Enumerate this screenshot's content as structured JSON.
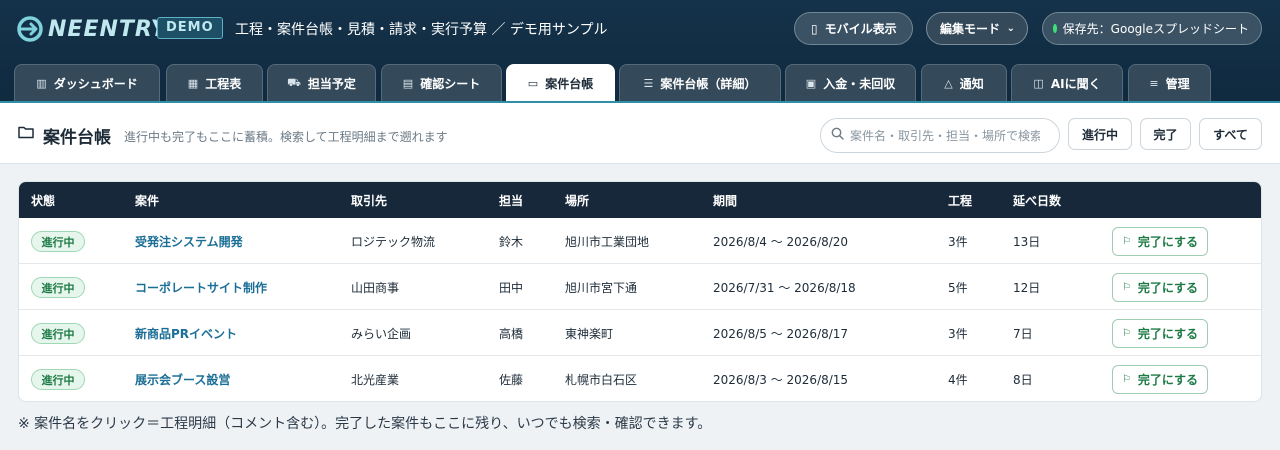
{
  "header": {
    "logo_text": "NEENTRY",
    "badge": "DEMO",
    "title": "工程・案件台帳・見積・請求・実行予算 ／ デモ用サンプル",
    "mobile_label": "モバイル表示",
    "mode_label": "編集モード",
    "save_label": "保存先：Googleスプレッドシート",
    "colors": {
      "bg": "#14324a",
      "accent": "#2e8fa6",
      "status_dot": "#3ee07a"
    }
  },
  "tabs": [
    {
      "label": "ダッシュボード",
      "icon": "bar-chart-icon"
    },
    {
      "label": "工程表",
      "icon": "calendar-icon"
    },
    {
      "label": "担当予定",
      "icon": "truck-icon"
    },
    {
      "label": "確認シート",
      "icon": "clipboard-icon"
    },
    {
      "label": "案件台帳",
      "icon": "folder-icon",
      "active": true
    },
    {
      "label": "案件台帳（詳細）",
      "icon": "list-icon"
    },
    {
      "label": "入金・未回収",
      "icon": "money-icon"
    },
    {
      "label": "通知",
      "icon": "bell-icon"
    },
    {
      "label": "AIに聞く",
      "icon": "robot-icon"
    },
    {
      "label": "管理",
      "icon": "sliders-icon"
    }
  ],
  "toolbar": {
    "title": "案件台帳",
    "subtitle": "進行中も完了もここに蓄積。検索して工程明細まで遡れます",
    "search_placeholder": "案件名・取引先・担当・場所で検索",
    "filters": [
      "進行中",
      "完了",
      "すべて"
    ]
  },
  "table": {
    "headers": [
      "状態",
      "案件",
      "取引先",
      "担当",
      "場所",
      "期間",
      "工程",
      "延べ日数"
    ],
    "rows": [
      {
        "status": "進行中",
        "case": "受発注システム開発",
        "client": "ロジテック物流",
        "owner": "鈴木",
        "place": "旭川市工業団地",
        "period": "2026/8/4 〜 2026/8/20",
        "steps": "3件",
        "days": "13日",
        "action": "完了にする"
      },
      {
        "status": "進行中",
        "case": "コーポレートサイト制作",
        "client": "山田商事",
        "owner": "田中",
        "place": "旭川市宮下通",
        "period": "2026/7/31 〜 2026/8/18",
        "steps": "5件",
        "days": "12日",
        "action": "完了にする"
      },
      {
        "status": "進行中",
        "case": "新商品PRイベント",
        "client": "みらい企画",
        "owner": "高橋",
        "place": "東神楽町",
        "period": "2026/8/5 〜 2026/8/17",
        "steps": "3件",
        "days": "7日",
        "action": "完了にする"
      },
      {
        "status": "進行中",
        "case": "展示会ブース設営",
        "client": "北光産業",
        "owner": "佐藤",
        "place": "札幌市白石区",
        "period": "2026/8/3 〜 2026/8/15",
        "steps": "4件",
        "days": "8日",
        "action": "完了にする"
      }
    ]
  },
  "footnote": "※ 案件名をクリック＝工程明細（コメント含む）。完了した案件もここに残り、いつでも検索・確認できます。"
}
